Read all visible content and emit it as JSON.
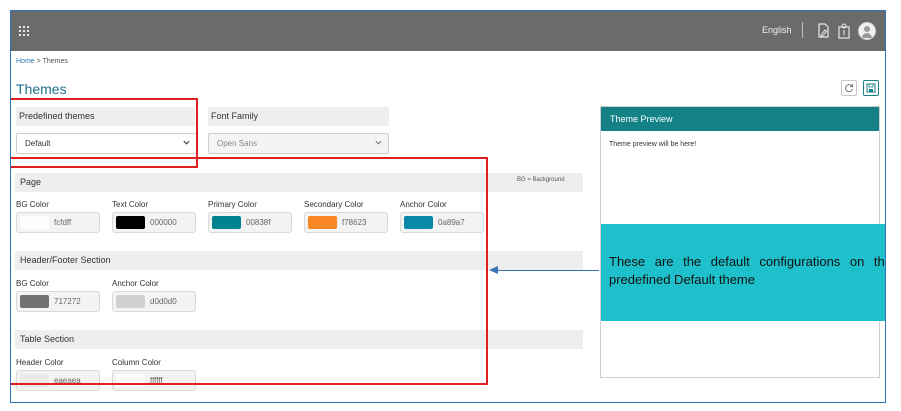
{
  "topbar": {
    "language": "English"
  },
  "breadcrumb": {
    "home": "Home",
    "separator": ">",
    "current": "Themes"
  },
  "page": {
    "title": "Themes"
  },
  "predefined": {
    "label": "Predefined themes",
    "value": "Default"
  },
  "font_family": {
    "label": "Font Family",
    "value": "Open Sans"
  },
  "page_section": {
    "title": "Page",
    "note": "BG = Background",
    "fields": [
      {
        "label": "BG Color",
        "hex": "fcfdff",
        "color": "#fcfdff"
      },
      {
        "label": "Text Color",
        "hex": "000000",
        "color": "#000000"
      },
      {
        "label": "Primary Color",
        "hex": "00838f",
        "color": "#00838f"
      },
      {
        "label": "Secondary Color",
        "hex": "f78623",
        "color": "#f78623"
      },
      {
        "label": "Anchor Color",
        "hex": "0a89a7",
        "color": "#0a89a7"
      }
    ]
  },
  "header_section": {
    "title": "Header/Footer Section",
    "fields": [
      {
        "label": "BG Color",
        "hex": "717272",
        "color": "#717272"
      },
      {
        "label": "Anchor Color",
        "hex": "d0d0d0",
        "color": "#d0d0d0"
      }
    ]
  },
  "table_section": {
    "title": "Table Section",
    "fields": [
      {
        "label": "Header Color",
        "hex": "eaeaea",
        "color": "#eaeaea"
      },
      {
        "label": "Column Color",
        "hex": "ffffff",
        "color": "#ffffff"
      }
    ]
  },
  "preview": {
    "title": "Theme Preview",
    "body": "Theme preview will be here!"
  },
  "annotation": {
    "text": "These are the default configurations on the predefined Default theme"
  },
  "colors": {
    "accent": "#138185",
    "topbar": "#6b6b6b",
    "callout": "#1ec1cb",
    "highlight": "#e02020"
  }
}
